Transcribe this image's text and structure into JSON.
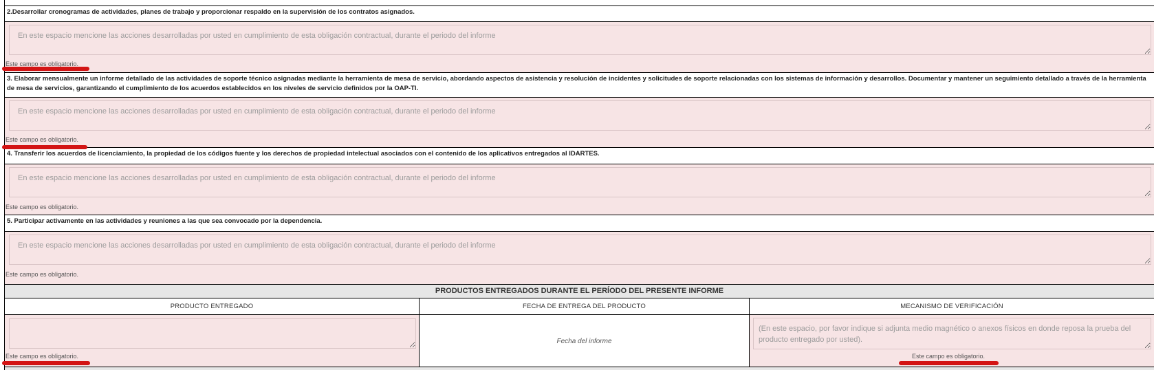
{
  "obligations": [
    {
      "text": "2.Desarrollar cronogramas de actividades, planes de trabajo y proporcionar respaldo en la supervisión de los contratos asignados."
    },
    {
      "text": "3. Elaborar mensualmente un informe detallado de las actividades de soporte técnico asignadas mediante la herramienta de mesa de servicio, abordando aspectos de asistencia y resolución de incidentes y solicitudes de soporte relacionadas con los sistemas de información y desarrollos. Documentar y mantener un seguimiento detallado a través de la herramienta de mesa de servicios, garantizando el cumplimiento de los acuerdos establecidos en los niveles de servicio definidos por la OAP-TI."
    },
    {
      "text": "4. Transferir los acuerdos de licenciamiento, la propiedad de los códigos fuente y los derechos de propiedad intelectual asociados con el contenido de los aplicativos entregados al IDARTES."
    },
    {
      "text": "5. Participar activamente en las actividades y reuniones a las que sea convocado por la dependencia."
    }
  ],
  "actions_placeholder": "En este espacio mencione las acciones desarrolladas por usted en cumplimiento de esta obligación contractual, durante el periodo del informe",
  "required_text": "Este campo es obligatorio.",
  "products": {
    "title": "PRODUCTOS ENTREGADOS DURANTE EL PERÍODO DEL PRESENTE INFORME",
    "col_product": "PRODUCTO ENTREGADO",
    "col_date": "FECHA DE ENTREGA DEL PRODUCTO",
    "col_mechanism": "MECANISMO DE VERIFICACIÓN",
    "date_placeholder": "Fecha del informe",
    "mechanism_placeholder": "(En este espacio, por favor indique si adjunta medio magnético o anexos físicos en donde reposa la prueba del producto entregado por usted)."
  },
  "colors": {
    "required_field_bg": "#f7e4e5",
    "annotation_mark": "#d31414",
    "header_bg": "#e6e6e6"
  }
}
